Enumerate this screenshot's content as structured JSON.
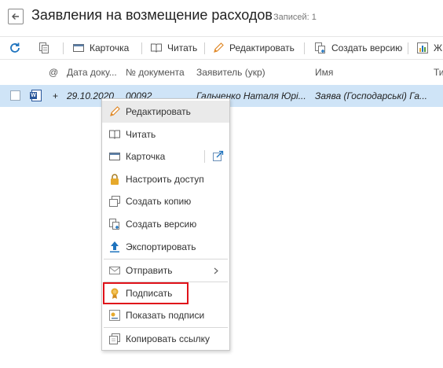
{
  "header": {
    "title": "Заявления на возмещение расходов",
    "record_count": "Записей: 1"
  },
  "toolbar": {
    "refresh_icon": "refresh-icon",
    "copy_icon": "copy-icon",
    "card_label": "Карточка",
    "read_label": "Читать",
    "edit_label": "Редактировать",
    "create_version_label": "Создать версию",
    "journal_label": "Ж"
  },
  "grid": {
    "columns": [
      "@",
      "Дата доку...",
      "№ документа",
      "Заявитель (укр)",
      "Имя",
      "Ти"
    ],
    "rows": [
      {
        "expand": "+",
        "date": "29.10.2020",
        "number": "00092",
        "applicant": "Гальченко Наталя Юрі...",
        "name": "Заява (Господарські) Га..."
      }
    ]
  },
  "context_menu": {
    "items": [
      {
        "label": "Редактировать",
        "icon": "pencil-icon"
      },
      {
        "label": "Читать",
        "icon": "book-icon"
      },
      {
        "label": "Карточка",
        "icon": "card-icon"
      },
      {
        "label": "Настроить доступ",
        "icon": "lock-icon"
      },
      {
        "label": "Создать копию",
        "icon": "copy-icon"
      },
      {
        "label": "Создать версию",
        "icon": "version-icon"
      },
      {
        "label": "Экспортировать",
        "icon": "export-arrow-icon"
      },
      {
        "label": "Отправить",
        "icon": "send-icon"
      },
      {
        "label": "Подписать",
        "icon": "sign-medal-icon"
      },
      {
        "label": "Показать подписи",
        "icon": "certificate-icon"
      },
      {
        "label": "Копировать ссылку",
        "icon": "link-copy-icon"
      }
    ]
  },
  "colors": {
    "selected_row": "#cfe4f7",
    "accent_blue": "#1e73be",
    "highlight_red": "#e0121a",
    "pencil_orange": "#e08a2a",
    "sign_gold": "#e6a92c"
  }
}
